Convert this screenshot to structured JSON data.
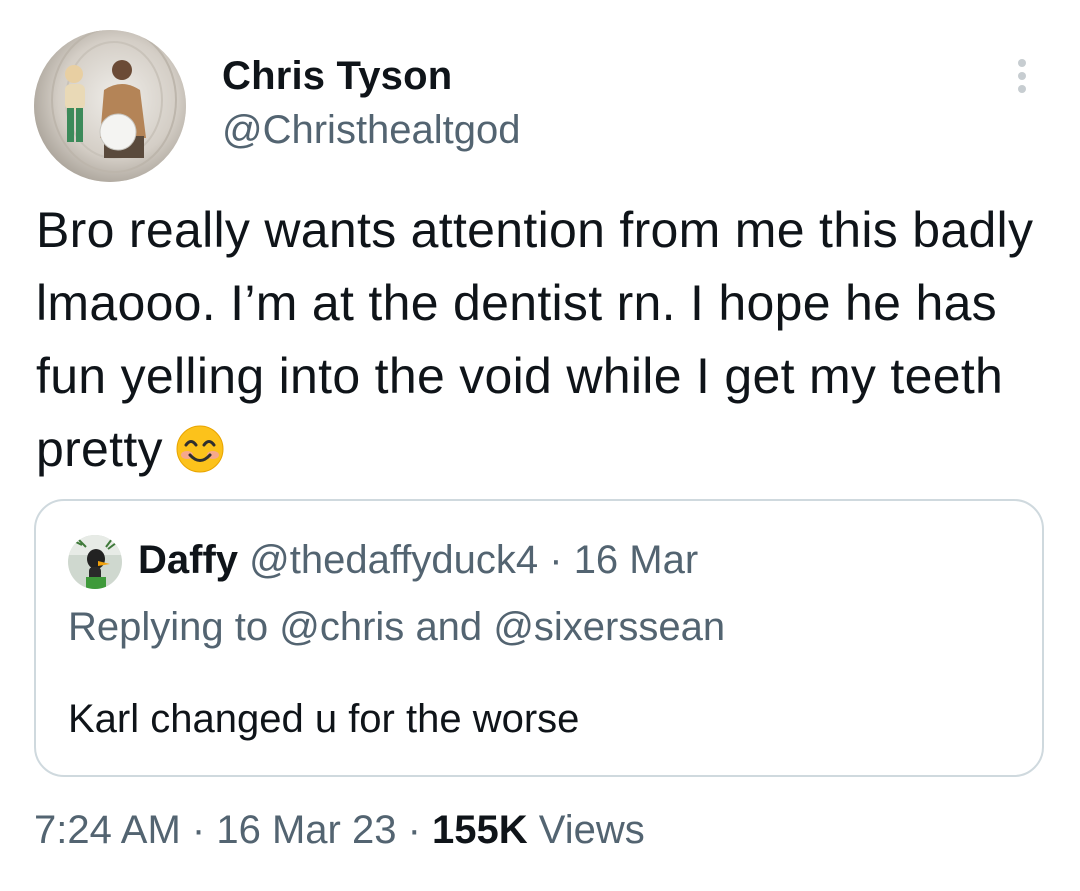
{
  "tweet": {
    "author": {
      "name": "Chris Tyson",
      "handle": "@Christhealtgod"
    },
    "text": "Bro really wants attention from me this badly lmaooo. I’m at the dentist rn. I hope he has fun yelling into the void while I get my teeth pretty",
    "emoji": "smiling-face-with-smiling-eyes",
    "quoted": {
      "name": "Daffy",
      "handle": "@thedaffyduck4",
      "separator": "·",
      "date": "16 Mar",
      "reply_prefix": "Replying to",
      "reply_user1": "@chris",
      "reply_and": "and",
      "reply_user2": "@sixerssean",
      "text": "Karl changed u for the worse"
    },
    "meta": {
      "time": "7:24 AM",
      "separator": "·",
      "date": "16 Mar 23",
      "views_count": "155K",
      "views_label": "Views"
    }
  },
  "colors": {
    "text_primary": "#0f1419",
    "text_secondary": "#536471",
    "border": "#cfd9de"
  }
}
